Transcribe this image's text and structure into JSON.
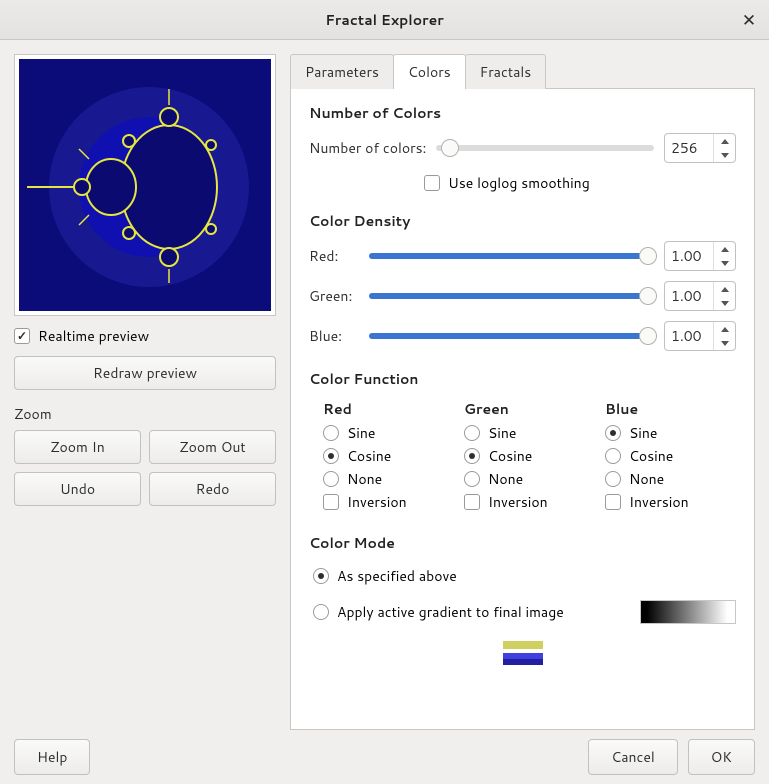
{
  "window": {
    "title": "Fractal Explorer"
  },
  "preview": {
    "realtime_label": "Realtime preview",
    "realtime_checked": true,
    "redraw_label": "Redraw preview"
  },
  "zoom": {
    "heading": "Zoom",
    "in": "Zoom In",
    "out": "Zoom Out",
    "undo": "Undo",
    "redo": "Redo"
  },
  "tabs": {
    "parameters": "Parameters",
    "colors": "Colors",
    "fractals": "Fractals",
    "active": "colors"
  },
  "colors_tab": {
    "num_colors_heading": "Number of Colors",
    "num_colors_label": "Number of colors:",
    "num_colors_value": "256",
    "loglog_label": "Use loglog smoothing",
    "loglog_checked": false,
    "density_heading": "Color Density",
    "density": {
      "red": {
        "label": "Red:",
        "value": "1.00"
      },
      "green": {
        "label": "Green:",
        "value": "1.00"
      },
      "blue": {
        "label": "Blue:",
        "value": "1.00"
      }
    },
    "function_heading": "Color Function",
    "function_columns": {
      "red": {
        "head": "Red",
        "sine": "Sine",
        "cosine": "Cosine",
        "none": "None",
        "inversion": "Inversion",
        "selected": "cosine",
        "inversion_checked": false
      },
      "green": {
        "head": "Green",
        "sine": "Sine",
        "cosine": "Cosine",
        "none": "None",
        "inversion": "Inversion",
        "selected": "cosine",
        "inversion_checked": false
      },
      "blue": {
        "head": "Blue",
        "sine": "Sine",
        "cosine": "Cosine",
        "none": "None",
        "inversion": "Inversion",
        "selected": "sine",
        "inversion_checked": false
      }
    },
    "mode_heading": "Color Mode",
    "mode": {
      "as_specified": "As specified above",
      "apply_gradient": "Apply active gradient to final image",
      "selected": "as_specified"
    }
  },
  "footer": {
    "help": "Help",
    "cancel": "Cancel",
    "ok": "OK"
  }
}
